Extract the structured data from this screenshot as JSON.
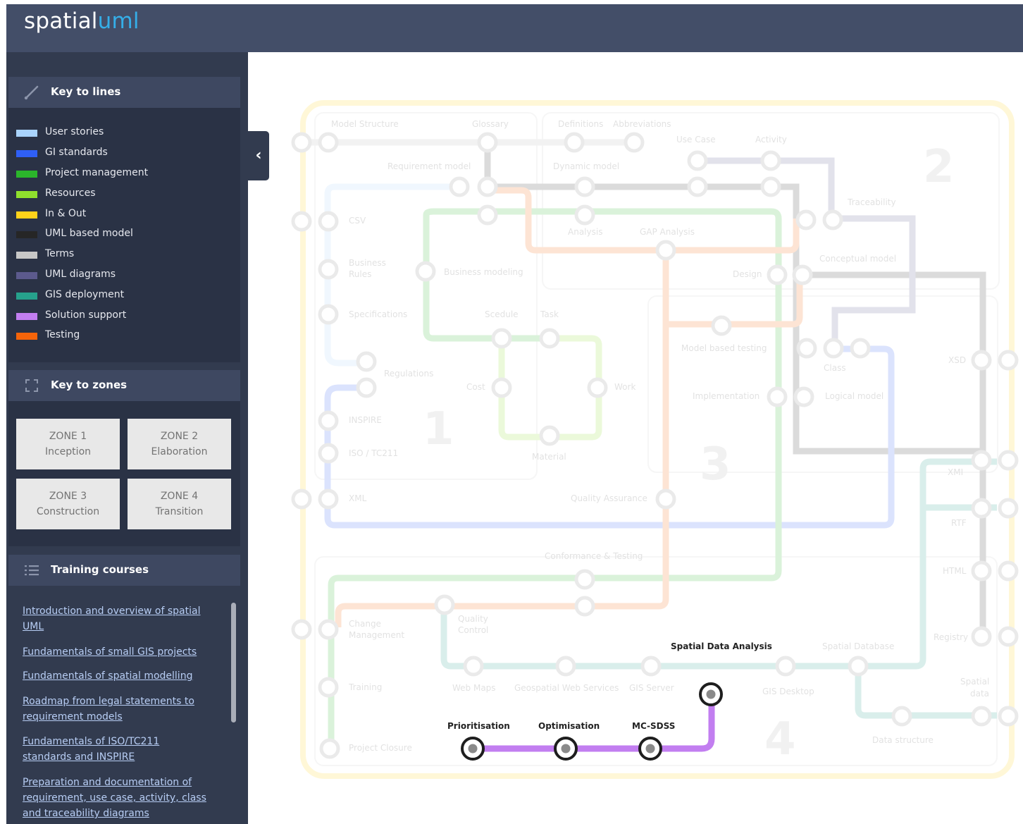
{
  "header": {
    "logo_part1": "spatial",
    "logo_part2": "uml"
  },
  "colors": {
    "topbar": "#434e68",
    "sidebar": "#323b4f",
    "panel_header": "#3e4861",
    "logo_accent": "#35aee8",
    "solution_support": "#c27ef0"
  },
  "key_to_lines": {
    "title": "Key to lines",
    "icon": "line-icon",
    "items": [
      {
        "label": "User stories",
        "color": "#a9d3fc"
      },
      {
        "label": "GI standards",
        "color": "#2f5ff5"
      },
      {
        "label": "Project management",
        "color": "#2bb52b"
      },
      {
        "label": "Resources",
        "color": "#8fe02d"
      },
      {
        "label": "In & Out",
        "color": "#ffd21a"
      },
      {
        "label": "UML based model",
        "color": "#262626"
      },
      {
        "label": "Terms",
        "color": "#c8c8c8"
      },
      {
        "label": "UML diagrams",
        "color": "#5c5a8d"
      },
      {
        "label": "GIS deployment",
        "color": "#26a18c"
      },
      {
        "label": "Solution support",
        "color": "#c27ef0"
      },
      {
        "label": "Testing",
        "color": "#f5640a"
      }
    ]
  },
  "key_to_zones": {
    "title": "Key to zones",
    "icon": "zones-icon",
    "zones": [
      {
        "line1": "ZONE 1",
        "line2": "Inception"
      },
      {
        "line1": "ZONE 2",
        "line2": "Elaboration"
      },
      {
        "line1": "ZONE 3",
        "line2": "Construction"
      },
      {
        "line1": "ZONE 4",
        "line2": "Transition"
      }
    ]
  },
  "training": {
    "title": "Training courses",
    "icon": "list-icon",
    "courses": [
      "Introduction and overview of spatial UML",
      "Fundamentals of small GIS projects",
      "Fundamentals of spatial modelling",
      "Roadmap from legal statements to requirement models",
      "Fundamentals of ISO/TC211 standards and INSPIRE",
      "Preparation and documentation of requirement, use case, activity, class and traceability diagrams"
    ]
  },
  "collapse_icon": "chevron-left-icon",
  "map": {
    "zone_numbers": [
      "1",
      "2",
      "3",
      "4"
    ],
    "labels": {
      "model_structure": "Model Structure",
      "glossary": "Glossary",
      "definitions": "Definitions",
      "abbreviations": "Abbreviations",
      "use_case": "Use Case",
      "activity": "Activity",
      "requirement_model": "Requirement model",
      "dynamic_model": "Dynamic model",
      "traceability": "Traceability",
      "csv": "CSV",
      "analysis": "Analysis",
      "gap_analysis": "GAP Analysis",
      "conceptual_model": "Conceptual model",
      "business_rules_1": "Business",
      "business_rules_2": "Rules",
      "business_modeling": "Business modeling",
      "design": "Design",
      "specifications": "Specifications",
      "scedule": "Scedule",
      "task": "Task",
      "model_based_testing": "Model based testing",
      "class": "Class",
      "xsd": "XSD",
      "regulations": "Regulations",
      "cost": "Cost",
      "work": "Work",
      "implementation": "Implementation",
      "logical_model": "Logical model",
      "inspire": "INSPIRE",
      "iso_tc211": "ISO / TC211",
      "material": "Material",
      "xmi": "XMI",
      "xml": "XML",
      "quality_assurance": "Quality Assurance",
      "rtf": "RTF",
      "conformance_testing": "Conformance & Testing",
      "html": "HTML",
      "change_mgmt_1": "Change",
      "change_mgmt_2": "Management",
      "quality_control_1": "Quality",
      "quality_control_2": "Control",
      "registry": "Registry",
      "spatial_database": "Spatial Database",
      "training": "Training",
      "web_maps": "Web Maps",
      "geospatial_web_services": "Geospatial Web Services",
      "gis_server": "GIS Server",
      "gis_desktop": "GIS Desktop",
      "spatial_data_1": "Spatial",
      "spatial_data_2": "data",
      "project_closure": "Project Closure",
      "data_structure": "Data structure",
      "spatial_data_analysis": "Spatial Data Analysis",
      "prioritisation": "Prioritisation",
      "optimisation": "Optimisation",
      "mc_sdss": "MC-SDSS"
    }
  }
}
